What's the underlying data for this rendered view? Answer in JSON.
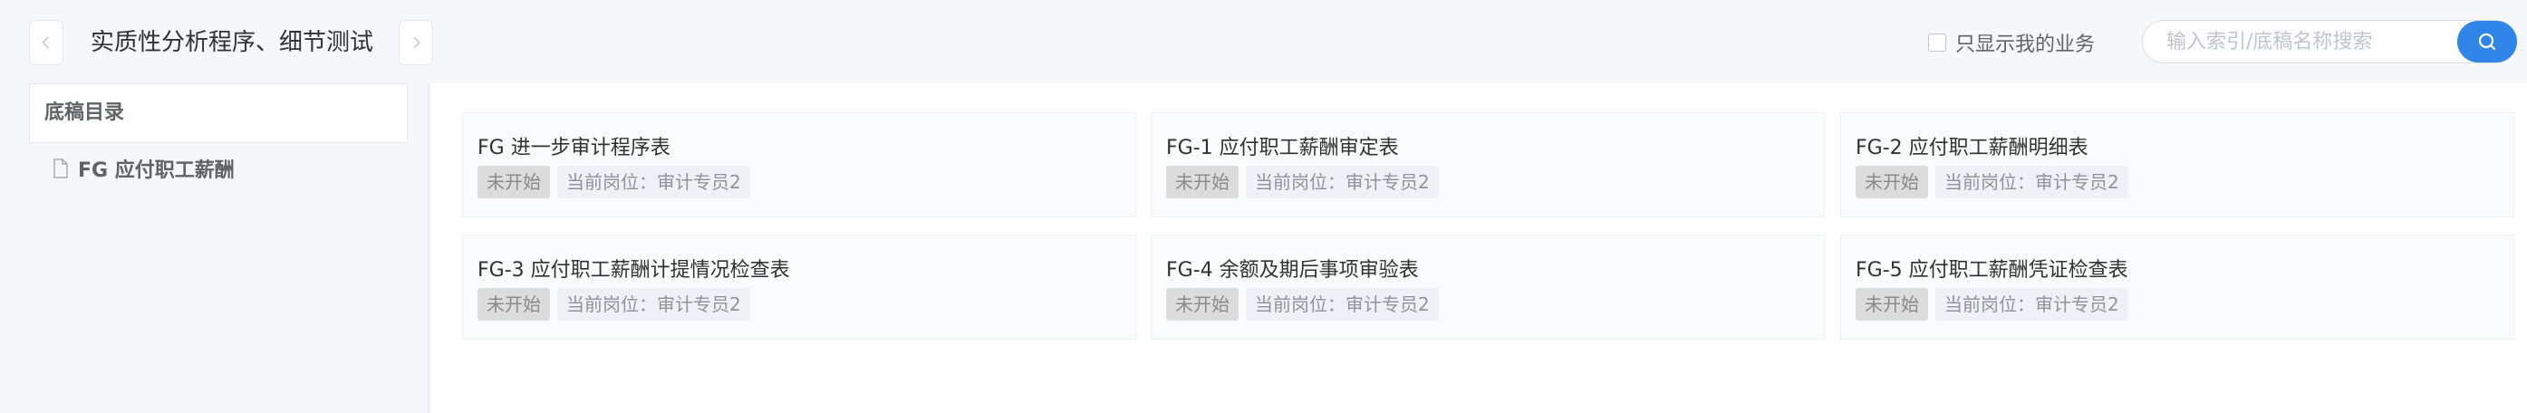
{
  "header": {
    "title": "实质性分析程序、细节测试",
    "only_mine_label": "只显示我的业务",
    "search_placeholder": "输入索引/底稿名称搜索"
  },
  "sidebar": {
    "heading": "底稿目录",
    "items": [
      {
        "label": "FG 应付职工薪酬"
      }
    ]
  },
  "cards": [
    {
      "title": "FG 进一步审计程序表",
      "status": "未开始",
      "role": "当前岗位：审计专员2"
    },
    {
      "title": "FG-1 应付职工薪酬审定表",
      "status": "未开始",
      "role": "当前岗位：审计专员2"
    },
    {
      "title": "FG-2 应付职工薪酬明细表",
      "status": "未开始",
      "role": "当前岗位：审计专员2"
    },
    {
      "title": "FG-3 应付职工薪酬计提情况检查表",
      "status": "未开始",
      "role": "当前岗位：审计专员2"
    },
    {
      "title": "FG-4 余额及期后事项审验表",
      "status": "未开始",
      "role": "当前岗位：审计专员2"
    },
    {
      "title": "FG-5 应付职工薪酬凭证检查表",
      "status": "未开始",
      "role": "当前岗位：审计专员2"
    }
  ],
  "colors": {
    "accent": "#2f86e8",
    "status_tag_bg": "#dcdcdc",
    "role_tag_bg": "#eef1f6"
  },
  "icons": [
    "chevron-left-icon",
    "chevron-right-icon",
    "search-icon",
    "document-icon"
  ]
}
